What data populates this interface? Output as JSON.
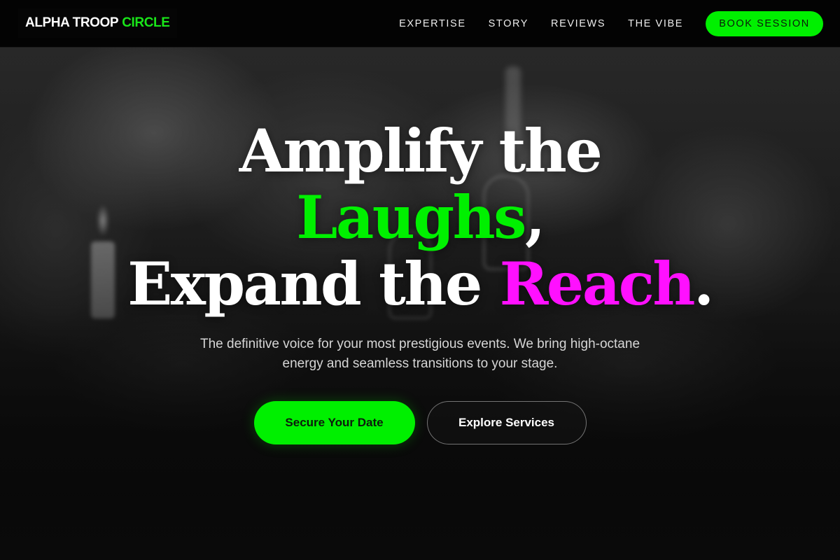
{
  "brand": {
    "name_main": "ALPHA TROOP",
    "name_accent": "CIRCLE"
  },
  "nav": {
    "links": [
      "EXPERTISE",
      "STORY",
      "REVIEWS",
      "THE VIBE"
    ],
    "cta_label": "BOOK SESSION"
  },
  "hero": {
    "headline": {
      "part1": "Amplify the",
      "highlight1": "Laughs",
      "comma": ",",
      "part2": "Expand the ",
      "highlight2": "Reach",
      "period": "."
    },
    "subtitle": "The definitive voice for your most prestigious events. We bring high-octane energy and seamless transitions to your stage.",
    "primary_cta": "Secure Your Date",
    "secondary_cta": "Explore Services"
  },
  "colors": {
    "accent_green": "#00f000",
    "accent_magenta": "#ff10ff",
    "background": "#0d0d0d"
  }
}
